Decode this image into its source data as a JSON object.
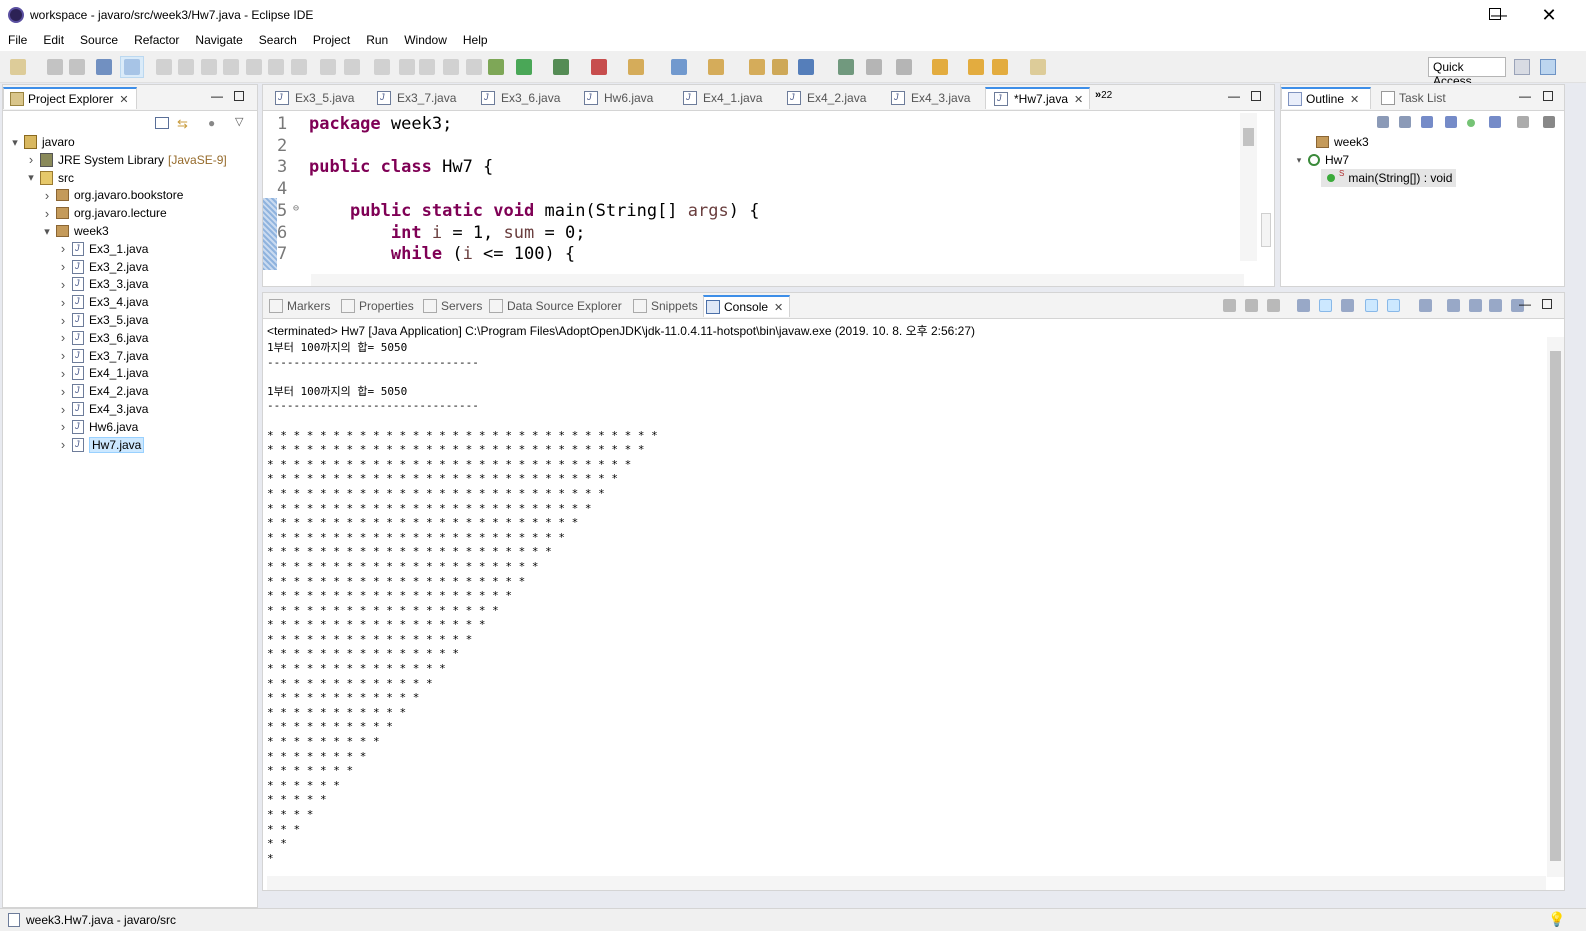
{
  "window": {
    "title": "workspace - javaro/src/week3/Hw7.java - Eclipse IDE"
  },
  "menu": [
    "File",
    "Edit",
    "Source",
    "Refactor",
    "Navigate",
    "Search",
    "Project",
    "Run",
    "Window",
    "Help"
  ],
  "toolbar": {
    "quick_access": "Quick Access"
  },
  "project_explorer": {
    "tab_label": "Project Explorer",
    "tree": [
      {
        "label": "javaro",
        "level": 0,
        "expanded": true,
        "type": "project"
      },
      {
        "label": "JRE System Library",
        "suffix": "[JavaSE-9]",
        "level": 1,
        "expanded": false,
        "type": "library"
      },
      {
        "label": "src",
        "level": 1,
        "expanded": true,
        "type": "folder"
      },
      {
        "label": "org.javaro.bookstore",
        "level": 2,
        "expanded": false,
        "type": "package"
      },
      {
        "label": "org.javaro.lecture",
        "level": 2,
        "expanded": false,
        "type": "package"
      },
      {
        "label": "week3",
        "level": 2,
        "expanded": true,
        "type": "package"
      },
      {
        "label": "Ex3_1.java",
        "level": 3,
        "type": "java"
      },
      {
        "label": "Ex3_2.java",
        "level": 3,
        "type": "java"
      },
      {
        "label": "Ex3_3.java",
        "level": 3,
        "type": "java"
      },
      {
        "label": "Ex3_4.java",
        "level": 3,
        "type": "java"
      },
      {
        "label": "Ex3_5.java",
        "level": 3,
        "type": "java"
      },
      {
        "label": "Ex3_6.java",
        "level": 3,
        "type": "java"
      },
      {
        "label": "Ex3_7.java",
        "level": 3,
        "type": "java"
      },
      {
        "label": "Ex4_1.java",
        "level": 3,
        "type": "java"
      },
      {
        "label": "Ex4_2.java",
        "level": 3,
        "type": "java"
      },
      {
        "label": "Ex4_3.java",
        "level": 3,
        "type": "java"
      },
      {
        "label": "Hw6.java",
        "level": 3,
        "type": "java"
      },
      {
        "label": "Hw7.java",
        "level": 3,
        "type": "java",
        "selected": true
      }
    ]
  },
  "editor": {
    "tabs": [
      "Ex3_5.java",
      "Ex3_7.java",
      "Ex3_6.java",
      "Hw6.java",
      "Ex4_1.java",
      "Ex4_2.java",
      "Ex4_3.java",
      "*Hw7.java"
    ],
    "active_tab": "*Hw7.java",
    "overflow": "22",
    "lines": [
      {
        "n": "1",
        "parts": [
          [
            "kw",
            "package"
          ],
          [
            "t",
            " week3;"
          ]
        ]
      },
      {
        "n": "2",
        "parts": []
      },
      {
        "n": "3",
        "parts": [
          [
            "kw",
            "public"
          ],
          [
            "t",
            " "
          ],
          [
            "kw",
            "class"
          ],
          [
            "t",
            " Hw7 {"
          ]
        ]
      },
      {
        "n": "4",
        "parts": []
      },
      {
        "n": "5",
        "parts": [
          [
            "t",
            "    "
          ],
          [
            "kw",
            "public"
          ],
          [
            "t",
            " "
          ],
          [
            "kw",
            "static"
          ],
          [
            "t",
            " "
          ],
          [
            "kw",
            "void"
          ],
          [
            "t",
            " main(String[] "
          ],
          [
            "var",
            "args"
          ],
          [
            "t",
            ") {"
          ]
        ]
      },
      {
        "n": "6",
        "parts": [
          [
            "t",
            "        "
          ],
          [
            "kw",
            "int"
          ],
          [
            "t",
            " "
          ],
          [
            "var",
            "i"
          ],
          [
            "t",
            " = 1, "
          ],
          [
            "var",
            "sum"
          ],
          [
            "t",
            " = 0;"
          ]
        ]
      },
      {
        "n": "7",
        "parts": [
          [
            "t",
            "        "
          ],
          [
            "kw",
            "while"
          ],
          [
            "t",
            " ("
          ],
          [
            "var",
            "i"
          ],
          [
            "t",
            " <= 100) {"
          ]
        ]
      }
    ]
  },
  "outline": {
    "tab_label": "Outline",
    "other_tab": "Task List",
    "items": [
      {
        "label": "week3",
        "level": 0
      },
      {
        "label": "Hw7",
        "level": 0,
        "expanded": true
      },
      {
        "label": "main(String[]) : void",
        "level": 1,
        "selected": true
      }
    ]
  },
  "bottom_panel": {
    "tabs": [
      "Markers",
      "Properties",
      "Servers",
      "Data Source Explorer",
      "Snippets",
      "Console"
    ],
    "active_tab": "Console",
    "header": "<terminated> Hw7 [Java Application] C:\\Program Files\\AdoptOpenJDK\\jdk-11.0.4.11-hotspot\\bin\\javaw.exe (2019. 10. 8. 오후 2:56:27)",
    "output_lines": [
      "1부터 100까지의 합= 5050",
      "--------------------------------",
      "",
      "1부터 100까지의 합= 5050",
      "--------------------------------",
      "",
      "* * * * * * * * * * * * * * * * * * * * * * * * * * * * * *",
      "* * * * * * * * * * * * * * * * * * * * * * * * * * * * *",
      "* * * * * * * * * * * * * * * * * * * * * * * * * * * *",
      "* * * * * * * * * * * * * * * * * * * * * * * * * * *",
      "* * * * * * * * * * * * * * * * * * * * * * * * * *",
      "* * * * * * * * * * * * * * * * * * * * * * * * *",
      "* * * * * * * * * * * * * * * * * * * * * * * *",
      "* * * * * * * * * * * * * * * * * * * * * * *",
      "* * * * * * * * * * * * * * * * * * * * * *",
      "* * * * * * * * * * * * * * * * * * * * *",
      "* * * * * * * * * * * * * * * * * * * *",
      "* * * * * * * * * * * * * * * * * * *",
      "* * * * * * * * * * * * * * * * * *",
      "* * * * * * * * * * * * * * * * *",
      "* * * * * * * * * * * * * * * *",
      "* * * * * * * * * * * * * * *",
      "* * * * * * * * * * * * * *",
      "* * * * * * * * * * * * *",
      "* * * * * * * * * * * *",
      "* * * * * * * * * * *",
      "* * * * * * * * * *",
      "* * * * * * * * *",
      "* * * * * * * *",
      "* * * * * * *",
      "* * * * * *",
      "* * * * *",
      "* * * *",
      "* * *",
      "* *",
      "*"
    ]
  },
  "status": {
    "text": "week3.Hw7.java - javaro/src"
  },
  "colors": {
    "keyword": "#7f0055",
    "variable": "#6a3e3e",
    "accent": "#3d8ee8",
    "selection": "#cce8ff"
  }
}
